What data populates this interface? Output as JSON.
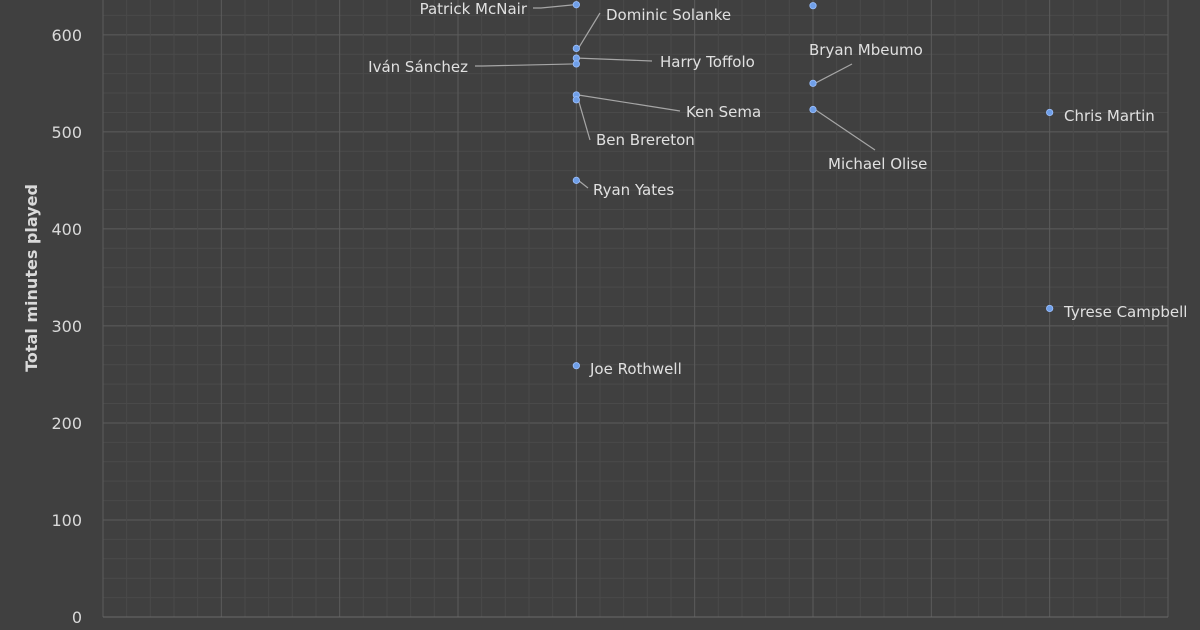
{
  "chart_data": {
    "type": "scatter",
    "title": "",
    "xlabel": "",
    "ylabel": "Total minutes played",
    "xlim": [
      0,
      9
    ],
    "ylim": [
      0,
      640
    ],
    "yticks": [
      0,
      100,
      200,
      300,
      400,
      500,
      600
    ],
    "grid": true,
    "colors": {
      "background": "#404040",
      "grid": "#5a5a5a",
      "point": "#6f9fe8",
      "text": "#d9d9d9",
      "leader": "#a6a6a6"
    },
    "points": [
      {
        "x": 4,
        "y": 631,
        "label": "Patrick McNair"
      },
      {
        "x": 4,
        "y": 586,
        "label": "Dominic Solanke"
      },
      {
        "x": 4,
        "y": 576,
        "label": "Harry Toffolo"
      },
      {
        "x": 4,
        "y": 570,
        "label": "Iván Sánchez"
      },
      {
        "x": 4,
        "y": 538,
        "label": "Ken Sema"
      },
      {
        "x": 4,
        "y": 533,
        "label": "Ben Brereton"
      },
      {
        "x": 4,
        "y": 450,
        "label": "Ryan Yates"
      },
      {
        "x": 4,
        "y": 259,
        "label": "Joe Rothwell"
      },
      {
        "x": 6,
        "y": 630,
        "label": ""
      },
      {
        "x": 6,
        "y": 550,
        "label": "Bryan Mbeumo"
      },
      {
        "x": 6,
        "y": 523,
        "label": "Michael Olise"
      },
      {
        "x": 8,
        "y": 520,
        "label": "Chris Martin"
      },
      {
        "x": 8,
        "y": 318,
        "label": "Tyrese Campbell"
      }
    ]
  }
}
